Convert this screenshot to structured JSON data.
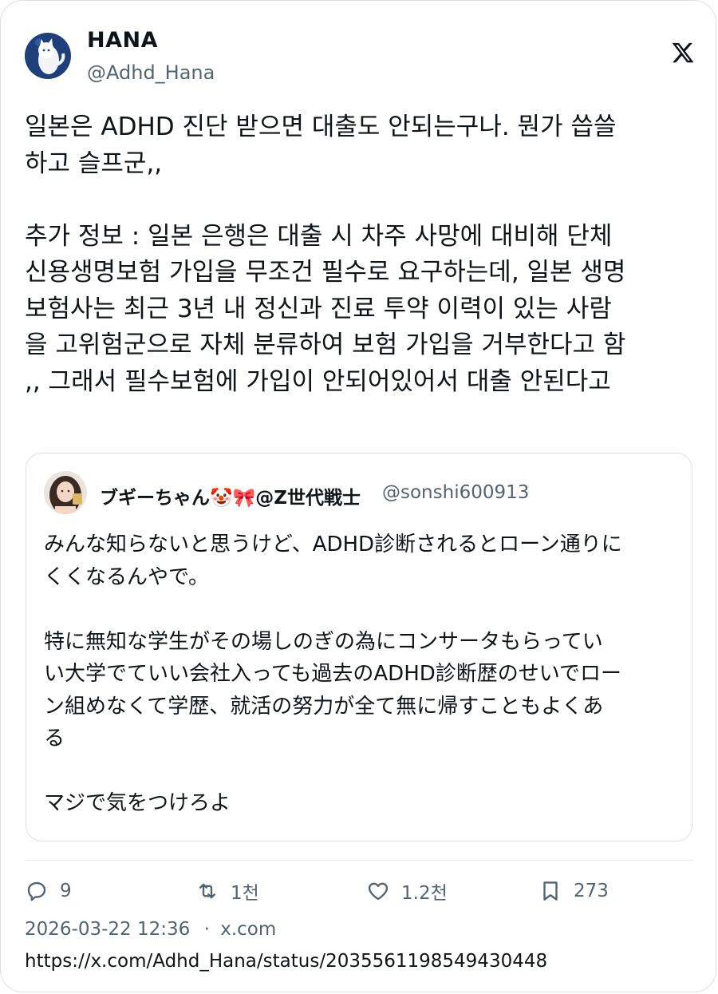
{
  "author": {
    "display_name": "HANA",
    "handle": "@Adhd_Hana",
    "avatar_icon": "cat-avatar-icon"
  },
  "tweet": {
    "text": "일본은 ADHD 진단 받으면 대출도 안되는구나. 뭔가 씁쓸\n하고 슬프군,,\n\n추가 정보 : 일본 은행은 대출 시 차주 사망에 대비해 단체\n신용생명보험 가입을 무조건 필수로 요구하는데, 일본 생명\n보험사는 최근 3년 내 정신과 진료 투약 이력이 있는 사람\n을 고위험군으로 자체 분류하여 보험 가입을 거부한다고 함\n,, 그래서 필수보험에 가입이 안되어있어서 대출 안된다고"
  },
  "quote": {
    "display_name": "ブギーちゃん🤡🎀@Z世代戦士",
    "handle": "@sonshi600913",
    "text": "みんな知らないと思うけど、ADHD診断されるとローン通りに\nくくなるんやで。\n\n特に無知な学生がその場しのぎの為にコンサータもらってい\nい大学でていい会社入っても過去のADHD診断歴のせいでロー\nン組めなくて学歴、就活の努力が全て無に帰すこともよくあ\nる\n\nマジで気をつけろよ"
  },
  "actions": {
    "replies": "9",
    "retweets": "1천",
    "likes": "1.2천",
    "bookmarks": "273"
  },
  "meta": {
    "timestamp": "2026-03-22 12:36",
    "separator": "·",
    "source": "x.com",
    "url": "https://x.com/Adhd_Hana/status/2035561198549430448"
  },
  "colors": {
    "text": "#0f1419",
    "secondary": "#536471",
    "border": "#dbe0e4"
  }
}
